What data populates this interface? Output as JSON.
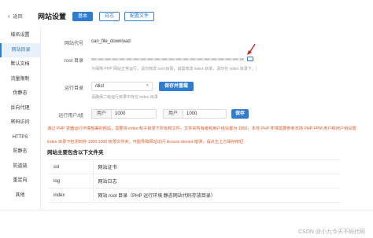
{
  "header": {
    "back_label": "返回",
    "title": "网站设置",
    "tabs": [
      {
        "label": "基本",
        "active": true
      },
      {
        "label": "日志",
        "active": false
      },
      {
        "label": "配置文件",
        "active": false
      }
    ]
  },
  "sidebar": {
    "items": [
      {
        "label": "域名设置",
        "active": false
      },
      {
        "label": "网站目录",
        "active": true
      },
      {
        "label": "默认文档",
        "active": false
      },
      {
        "label": "流量限制",
        "active": false
      },
      {
        "label": "伪静态",
        "active": false
      },
      {
        "label": "反向代理",
        "active": false
      },
      {
        "label": "密码访问",
        "active": false
      },
      {
        "label": "HTTPS",
        "active": false
      },
      {
        "label": "防静态",
        "active": false
      },
      {
        "label": "防盗链",
        "active": false
      },
      {
        "label": "重定向",
        "active": false
      },
      {
        "label": "其他",
        "active": false
      }
    ]
  },
  "form": {
    "site_code_label": "网站代号",
    "site_code_value": "can_file_download",
    "root_label": "root 目录",
    "root_hint": "为保障 PHP 网站正常运行，请勿修改 root 目录，如需修改 index 目录，请勿在 index 目录下，否则需要修改 index 目录。",
    "run_dir_label": "运行目录",
    "run_dir_value": "/dist",
    "save_reload_label": "保存并重载",
    "run_dir_hint": "请确保二级运行目录中存在 index 目录",
    "run_user_label": "运行用户/组",
    "user_addon": "用户",
    "user_value": "1000",
    "group_addon": "用户",
    "group_value": "1000",
    "save_label": "保存"
  },
  "warnings": [
    "通过 PHP 容器运行环境部署的网站，需要将 index 和子目录下所有和文件，文件夹所有者和用户组设置为 1000，本地 PHP 环境需要参考本地 PHP-FPM 用户和用户组设置",
    "index 目录下检测到存 1000:1000 权限文件夹，可能导致网站访问 Access denied 错误，请点击上方保存按钮"
  ],
  "table_section": {
    "title": "网站主要包含以下文件夹",
    "rows": [
      {
        "key": "ssl",
        "desc": "网站证书"
      },
      {
        "key": "log",
        "desc": "网站日志"
      },
      {
        "key": "index",
        "desc": "网站 root 目录（PHP 运行环境 静态网站代码存放目录）"
      }
    ]
  },
  "footer": {
    "watermark": "CSDN @小九今天不码代码"
  },
  "colors": {
    "accent": "#2f7dd1",
    "warning": "#e35d2a"
  }
}
